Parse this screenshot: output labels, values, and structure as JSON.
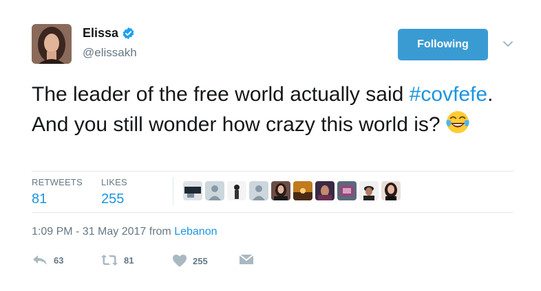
{
  "author": {
    "name": "Elissa",
    "handle": "@elissakh",
    "verified": true,
    "verified_color": "#1da1f2"
  },
  "follow_button": {
    "label": "Following",
    "color": "#3a9bd3"
  },
  "tweet": {
    "text_before": "The leader of the free world actually said ",
    "hashtag": "#covfefe",
    "text_after": ". And you still wonder how crazy this world is?",
    "emoji": "face-with-tears-of-joy"
  },
  "stats": {
    "retweets_label": "RETWEETS",
    "retweets_value": "81",
    "likes_label": "LIKES",
    "likes_value": "255"
  },
  "likers": [
    "photo",
    "default",
    "photo-bw",
    "default",
    "photo",
    "photo-sunset",
    "photo",
    "photo",
    "photo",
    "photo"
  ],
  "meta": {
    "time": "1:09 PM - 31 May 2017 from ",
    "location": "Lebanon"
  },
  "actions": {
    "reply_count": "63",
    "retweet_count": "81",
    "like_count": "255"
  },
  "colors": {
    "link": "#1b95e0",
    "muted": "#657786",
    "icon": "#aab8c2"
  }
}
